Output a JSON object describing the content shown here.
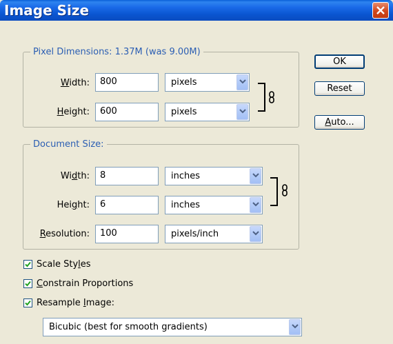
{
  "window": {
    "title": "Image Size"
  },
  "pixel_dimensions": {
    "legend": "Pixel Dimensions:  1.37M (was 9.00M)",
    "width_label_pre": "",
    "width_label_u": "W",
    "width_label_post": "idth:",
    "width_value": "800",
    "width_unit": "pixels",
    "height_label_u": "H",
    "height_label_post": "eight:",
    "height_value": "600",
    "height_unit": "pixels"
  },
  "document_size": {
    "legend": "Document Size:",
    "width_label_pre": "Wi",
    "width_label_u": "d",
    "width_label_post": "th:",
    "width_value": "8",
    "width_unit": "inches",
    "height_label_pre": "Hei",
    "height_label_u": "g",
    "height_label_post": "ht:",
    "height_value": "6",
    "height_unit": "inches",
    "res_label_u": "R",
    "res_label_post": "esolution:",
    "res_value": "100",
    "res_unit": "pixels/inch"
  },
  "options": {
    "scale_styles_pre": "Scale Sty",
    "scale_styles_u": "l",
    "scale_styles_post": "es",
    "scale_styles_checked": true,
    "constrain_u": "C",
    "constrain_post": "onstrain Proportions",
    "constrain_checked": true,
    "resample_pre": "Resample ",
    "resample_u": "I",
    "resample_post": "mage:",
    "resample_checked": true,
    "resample_method": "Bicubic (best for smooth gradients)"
  },
  "buttons": {
    "ok": "OK",
    "reset": "Reset",
    "auto_u": "A",
    "auto_post": "uto..."
  },
  "colors": {
    "accent": "#2b5eb3",
    "titlebar": "#0a55d0"
  }
}
